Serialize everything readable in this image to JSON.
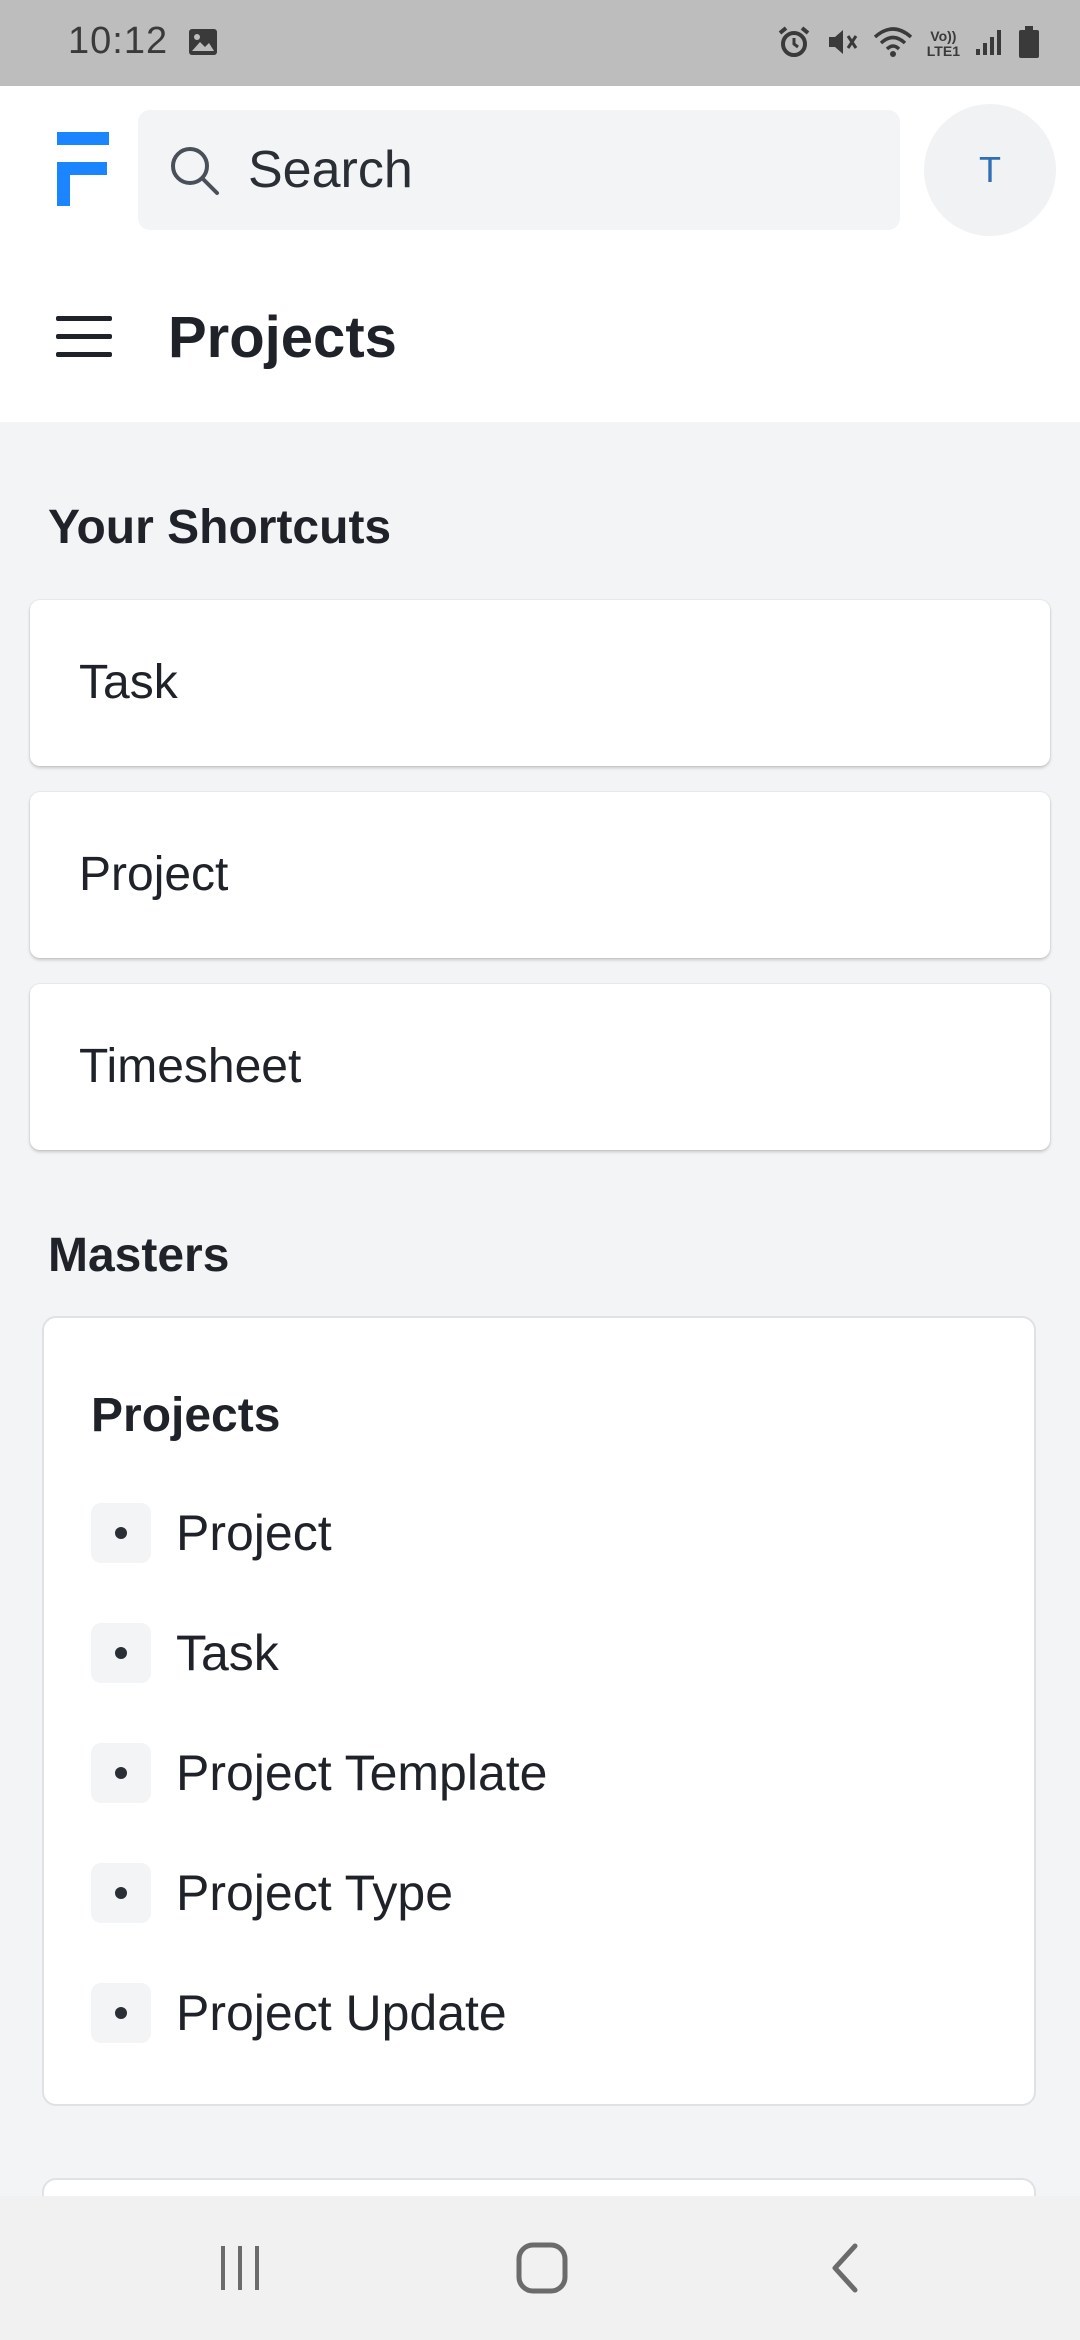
{
  "status_bar": {
    "time": "10:12",
    "left_icons": [
      "image-icon"
    ],
    "right_icons": [
      "alarm-icon",
      "mute-icon",
      "wifi-icon",
      "volte-icon",
      "signal-icon",
      "battery-icon"
    ],
    "volte_label_top": "Vo))",
    "volte_label_bottom": "LTE1"
  },
  "header": {
    "logo_letter": "F",
    "logo_color": "#1b84ff",
    "search": {
      "placeholder": "Search",
      "value": ""
    },
    "avatar_initial": "T"
  },
  "page": {
    "title": "Projects"
  },
  "shortcuts": {
    "heading": "Your Shortcuts",
    "items": [
      {
        "label": "Task"
      },
      {
        "label": "Project"
      },
      {
        "label": "Timesheet"
      }
    ]
  },
  "masters": {
    "heading": "Masters",
    "group_title": "Projects",
    "items": [
      {
        "label": "Project"
      },
      {
        "label": "Task"
      },
      {
        "label": "Project Template"
      },
      {
        "label": "Project Type"
      },
      {
        "label": "Project Update"
      }
    ]
  },
  "nav_bar": {
    "buttons": [
      "recents-icon",
      "home-icon",
      "back-icon"
    ]
  }
}
